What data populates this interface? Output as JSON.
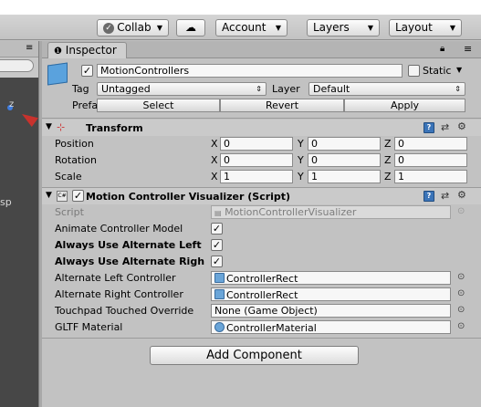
{
  "toolbar": {
    "collab_label": "Collab",
    "account_label": "Account",
    "layers_label": "Layers",
    "layout_label": "Layout"
  },
  "left_pane": {
    "partial_text": "sp"
  },
  "inspector": {
    "tab_label": "Inspector",
    "object": {
      "name": "MotionControllers",
      "static_label": "Static",
      "tag_label": "Tag",
      "tag_value": "Untagged",
      "layer_label": "Layer",
      "layer_value": "Default",
      "prefab_label": "Prefab",
      "prefab_buttons": [
        "Select",
        "Revert",
        "Apply"
      ]
    },
    "transform": {
      "title": "Transform",
      "rows": [
        {
          "label": "Position",
          "x": "0",
          "y": "0",
          "z": "0"
        },
        {
          "label": "Rotation",
          "x": "0",
          "y": "0",
          "z": "0"
        },
        {
          "label": "Scale",
          "x": "1",
          "y": "1",
          "z": "1"
        }
      ],
      "axis_x": "X",
      "axis_y": "Y",
      "axis_z": "Z"
    },
    "script_component": {
      "title": "Motion Controller Visualizer (Script)",
      "script_label": "Script",
      "script_value": "MotionControllerVisualizer",
      "animate_label": "Animate Controller Model",
      "alt_left_label": "Always Use Alternate Left",
      "alt_right_label": "Always Use Alternate Righ",
      "alt_left_ctrl_label": "Alternate Left Controller",
      "alt_left_ctrl_value": "ControllerRect",
      "alt_right_ctrl_label": "Alternate Right Controller",
      "alt_right_ctrl_value": "ControllerRect",
      "touchpad_label": "Touchpad Touched Override",
      "touchpad_value": "None (Game Object)",
      "gltf_label": "GLTF Material",
      "gltf_value": "ControllerMaterial"
    },
    "add_component_label": "Add Component"
  }
}
